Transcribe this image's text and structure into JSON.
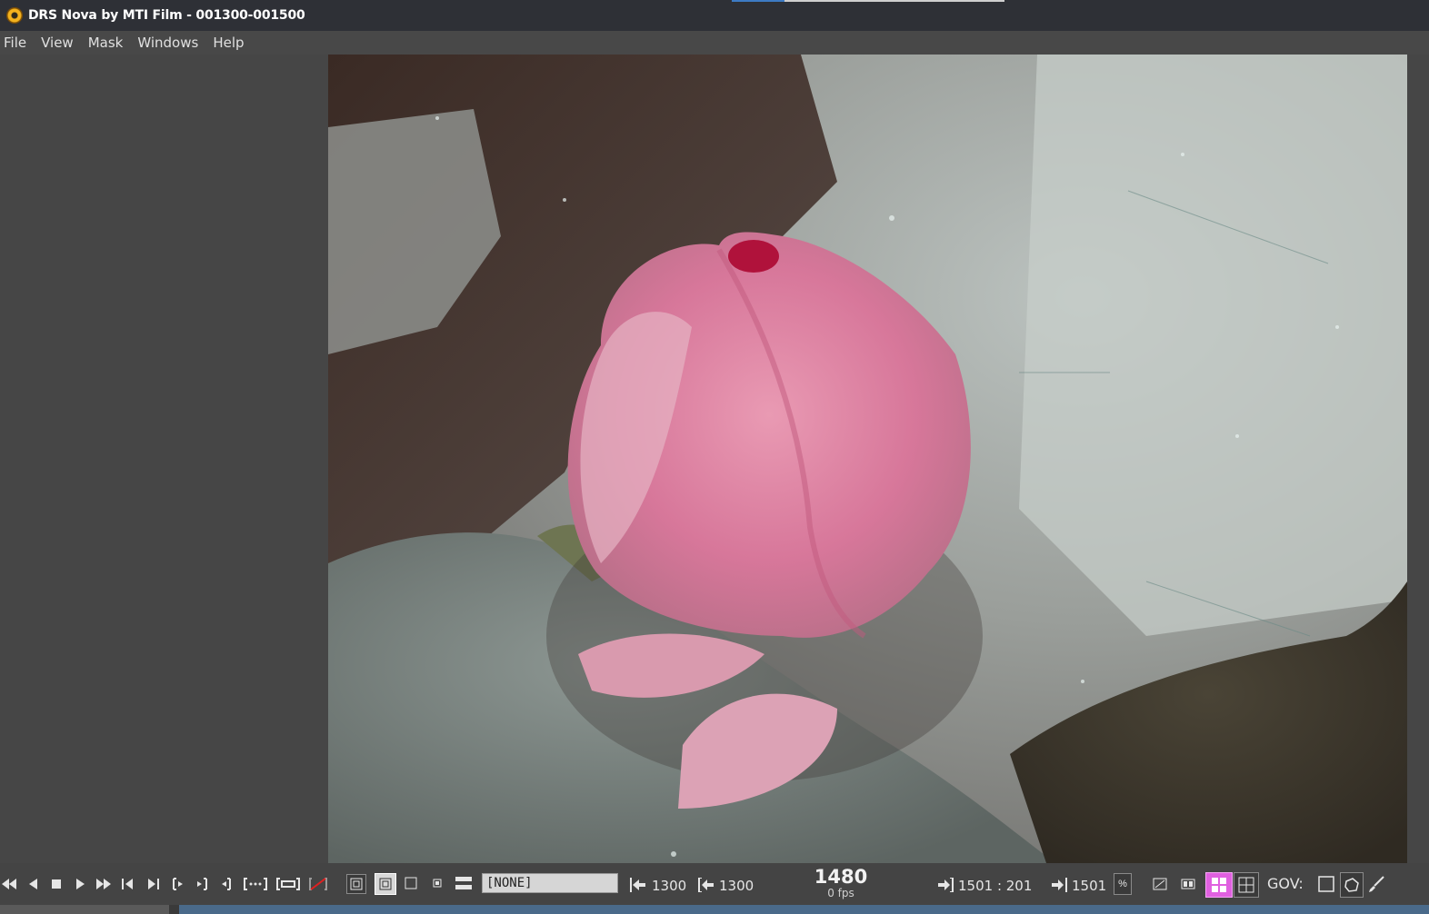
{
  "window": {
    "title": "DRS Nova by MTI Film - 001300-001500"
  },
  "menu": [
    "File",
    "View",
    "Mask",
    "Windows",
    "Help"
  ],
  "viewer": {
    "image": "film-frame-pink-lotus-bud"
  },
  "transport": {
    "icons": [
      "rewind-icon",
      "step-back-icon",
      "stop-icon",
      "play-icon",
      "fast-forward-icon",
      "prev-frame-icon",
      "next-frame-icon",
      "goto-in-icon",
      "goto-out-icon",
      "mark-in-icon",
      "play-range-icon",
      "loop-range-icon",
      "clear-marks-icon"
    ]
  },
  "display_modes": [
    "display-mode-full",
    "display-mode-1",
    "display-mode-2",
    "display-mode-3"
  ],
  "mask_select": {
    "value": "[NONE]"
  },
  "in_point": {
    "value": "1300"
  },
  "mark_in": {
    "value": "1300"
  },
  "current_frame": {
    "value": "1480",
    "fps": "0 fps"
  },
  "out_point": {
    "value": "1501 : 201"
  },
  "mark_out": {
    "value": "1501"
  },
  "gov": {
    "label": "GOV:"
  },
  "colors": {
    "titlebar": "#2e3036",
    "menubar": "#484848",
    "panel": "#464646",
    "toolbar": "#444444",
    "accent_magenta": "#e060e0"
  }
}
